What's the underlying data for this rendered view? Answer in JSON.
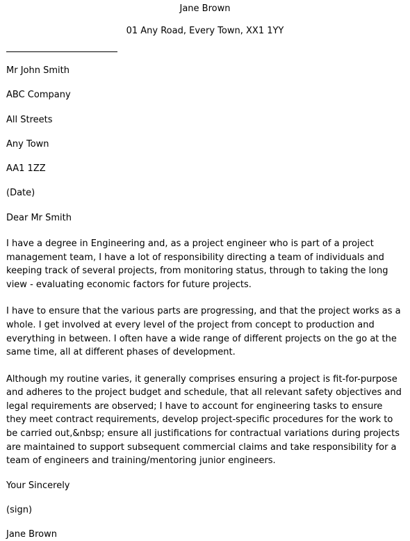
{
  "document": {
    "type": "cover-letter",
    "sender": {
      "name": "Jane Brown",
      "address": "01 Any Road, Every Town, XX1 1YY"
    },
    "recipient": {
      "lines": [
        "Mr John Smith",
        "ABC Company",
        "All Streets",
        "Any Town",
        "AA1 1ZZ"
      ]
    },
    "date": "(Date)",
    "salutation": "Dear Mr Smith",
    "body": [
      "I have a degree in Engineering and, as a project engineer who is part of a project management team, I have a lot of responsibility directing a team of individuals and keeping track of several projects, from monitoring status, through to taking the long view - evaluating economic factors for future projects.",
      "I have to ensure that the various parts are progressing, and that the project works as a whole. I get involved at every level of the project from concept to production and everything in between. I often have a wide range of different projects on the go at the same time, all at different phases of development.",
      "Although my routine varies, it generally comprises ensuring a project is fit-for-purpose and adheres to the project budget and schedule, that all relevant safety objectives and legal requirements are observed; I have to account for engineering tasks to ensure they meet contract requirements, develop project-specific procedures for the work to be carried out,&nbsp; ensure all justifications for contractual variations during projects are maintained to support subsequent commercial claims and take responsibility for a team of engineers and training/mentoring junior engineers."
    ],
    "closing": {
      "valediction": "Your Sincerely",
      "signature_placeholder": "(sign)",
      "signed_name": "Jane Brown"
    },
    "colors": {
      "text": "#000000",
      "background": "#ffffff",
      "rule": "#000000"
    }
  }
}
